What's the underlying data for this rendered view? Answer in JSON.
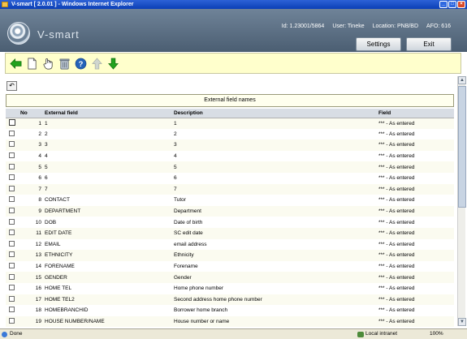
{
  "window": {
    "title": "V-smart [ 2.0.01 ] - Windows Internet Explorer",
    "min_label": "_",
    "max_label": "□",
    "close_label": "×"
  },
  "header": {
    "brand": "V-smart",
    "session_id": "Id: 1.23001/5864",
    "user": "User: Tineke",
    "location": "Location: PNB/BD",
    "afo": "AFO: 616",
    "settings_label": "Settings",
    "exit_label": "Exit"
  },
  "toolbar": {
    "icons": [
      "back-arrow-icon",
      "new-document-icon",
      "select-hand-icon",
      "delete-trash-icon",
      "help-icon",
      "move-up-icon",
      "move-down-icon"
    ],
    "colors": {
      "background": "#ffffcc",
      "arrow_green": "#22a21e",
      "help_blue": "#2462b8"
    }
  },
  "undo_label": "↶",
  "section_title": "External field names",
  "table": {
    "columns": {
      "no": "No",
      "external_field": "External field",
      "description": "Description",
      "field": "Field"
    },
    "rows": [
      {
        "no": "1",
        "external_field": "1",
        "description": "1",
        "field": "*** - As entered"
      },
      {
        "no": "2",
        "external_field": "2",
        "description": "2",
        "field": "*** - As entered"
      },
      {
        "no": "3",
        "external_field": "3",
        "description": "3",
        "field": "*** - As entered"
      },
      {
        "no": "4",
        "external_field": "4",
        "description": "4",
        "field": "*** - As entered"
      },
      {
        "no": "5",
        "external_field": "5",
        "description": "5",
        "field": "*** - As entered"
      },
      {
        "no": "6",
        "external_field": "6",
        "description": "6",
        "field": "*** - As entered"
      },
      {
        "no": "7",
        "external_field": "7",
        "description": "7",
        "field": "*** - As entered"
      },
      {
        "no": "8",
        "external_field": "CONTACT",
        "description": "Tutor",
        "field": "*** - As entered"
      },
      {
        "no": "9",
        "external_field": "DEPARTMENT",
        "description": "Department",
        "field": "*** - As entered"
      },
      {
        "no": "10",
        "external_field": "DOB",
        "description": "Date of birth",
        "field": "*** - As entered"
      },
      {
        "no": "11",
        "external_field": "EDIT DATE",
        "description": "SC edit date",
        "field": "*** - As entered"
      },
      {
        "no": "12",
        "external_field": "EMAIL",
        "description": "email address",
        "field": "*** - As entered"
      },
      {
        "no": "13",
        "external_field": "ETHNICITY",
        "description": "Ethnicity",
        "field": "*** - As entered"
      },
      {
        "no": "14",
        "external_field": "FORENAME",
        "description": "Forename",
        "field": "*** - As entered"
      },
      {
        "no": "15",
        "external_field": "GENDER",
        "description": "Gender",
        "field": "*** - As entered"
      },
      {
        "no": "16",
        "external_field": "HOME TEL",
        "description": "Home phone number",
        "field": "*** - As entered"
      },
      {
        "no": "17",
        "external_field": "HOME TEL2",
        "description": "Second address home phone number",
        "field": "*** - As entered"
      },
      {
        "no": "18",
        "external_field": "HOMEBRANCHID",
        "description": "Borrower home branch",
        "field": "*** - As entered"
      },
      {
        "no": "19",
        "external_field": "HOUSE NUMBER/NAME",
        "description": "House number or name",
        "field": "*** - As entered"
      }
    ]
  },
  "statusbar": {
    "done": "Done",
    "zone": "Local intranet",
    "zoom": "100%"
  }
}
